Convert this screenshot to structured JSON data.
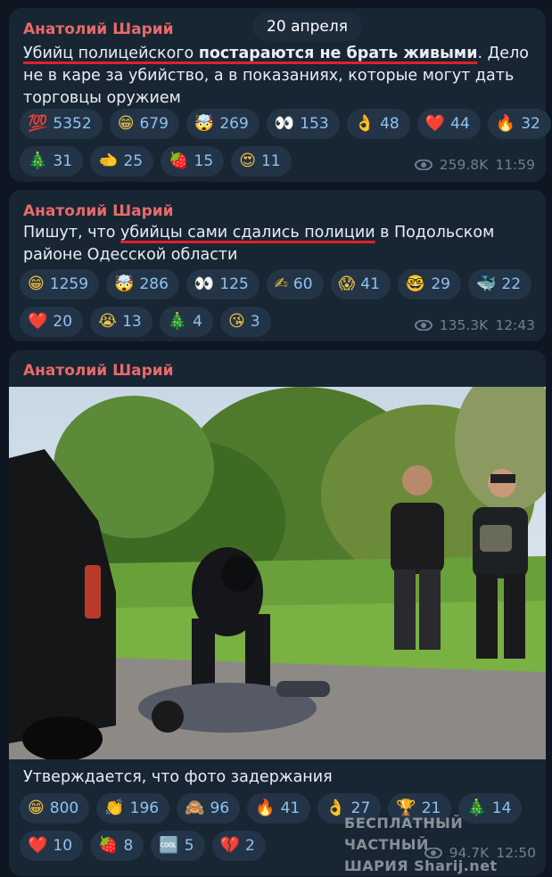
{
  "date_separator": "20 апреля",
  "messages": [
    {
      "author": "Анатолий Шарий",
      "text_parts": [
        "Убийц полицейского ",
        "постараются не брать живыми",
        ". Дело не в каре за убийство, а в показаниях, которые могут дать торговцы оружием"
      ],
      "reactions": [
        [
          {
            "emoji": "💯",
            "count": "5352"
          },
          {
            "emoji": "😁",
            "count": "679"
          },
          {
            "emoji": "🤯",
            "count": "269"
          },
          {
            "emoji": "👀",
            "count": "153"
          },
          {
            "emoji": "👌",
            "count": "48"
          },
          {
            "emoji": "❤️",
            "count": "44"
          },
          {
            "emoji": "🔥",
            "count": "32"
          }
        ],
        [
          {
            "emoji": "🎄",
            "count": "31"
          },
          {
            "emoji": "🫲",
            "count": "25"
          },
          {
            "emoji": "🍓",
            "count": "15"
          },
          {
            "emoji": "😍",
            "count": "11"
          }
        ]
      ],
      "views": "259.8K",
      "time": "11:59"
    },
    {
      "author": "Анатолий Шарий",
      "text_parts": [
        "Пишут, что ",
        "убийцы сами сдались полиции",
        " в Подольском районе Одесской области"
      ],
      "reactions": [
        [
          {
            "emoji": "😁",
            "count": "1259"
          },
          {
            "emoji": "🤯",
            "count": "286"
          },
          {
            "emoji": "👀",
            "count": "125"
          },
          {
            "emoji": "✍",
            "count": "60"
          },
          {
            "emoji": "😱",
            "count": "41"
          },
          {
            "emoji": "🤓",
            "count": "29"
          },
          {
            "emoji": "🐳",
            "count": "22"
          }
        ],
        [
          {
            "emoji": "❤️",
            "count": "20"
          },
          {
            "emoji": "😭",
            "count": "13"
          },
          {
            "emoji": "🎄",
            "count": "4"
          },
          {
            "emoji": "😘",
            "count": "3"
          }
        ]
      ],
      "views": "135.3K",
      "time": "12:43"
    },
    {
      "author": "Анатолий Шарий",
      "caption": "Утверждается, что фото задержания",
      "reactions": [
        [
          {
            "emoji": "😁",
            "count": "800"
          },
          {
            "emoji": "👏",
            "count": "196"
          },
          {
            "emoji": "🙈",
            "count": "96"
          },
          {
            "emoji": "🔥",
            "count": "41"
          },
          {
            "emoji": "👌",
            "count": "27"
          },
          {
            "emoji": "🏆",
            "count": "21"
          },
          {
            "emoji": "🎄",
            "count": "14"
          }
        ],
        [
          {
            "emoji": "❤️",
            "count": "10"
          },
          {
            "emoji": "🍓",
            "count": "8"
          },
          {
            "emoji": "🆒",
            "count": "5"
          },
          {
            "emoji": "💔",
            "count": "2"
          }
        ]
      ],
      "views": "94.7K",
      "time": "12:50"
    }
  ],
  "watermark": {
    "line1": "БЕСПЛАТНЫЙ ЧАСТНЫЙ",
    "line2": "ШАРИЯ Sharij.net"
  }
}
